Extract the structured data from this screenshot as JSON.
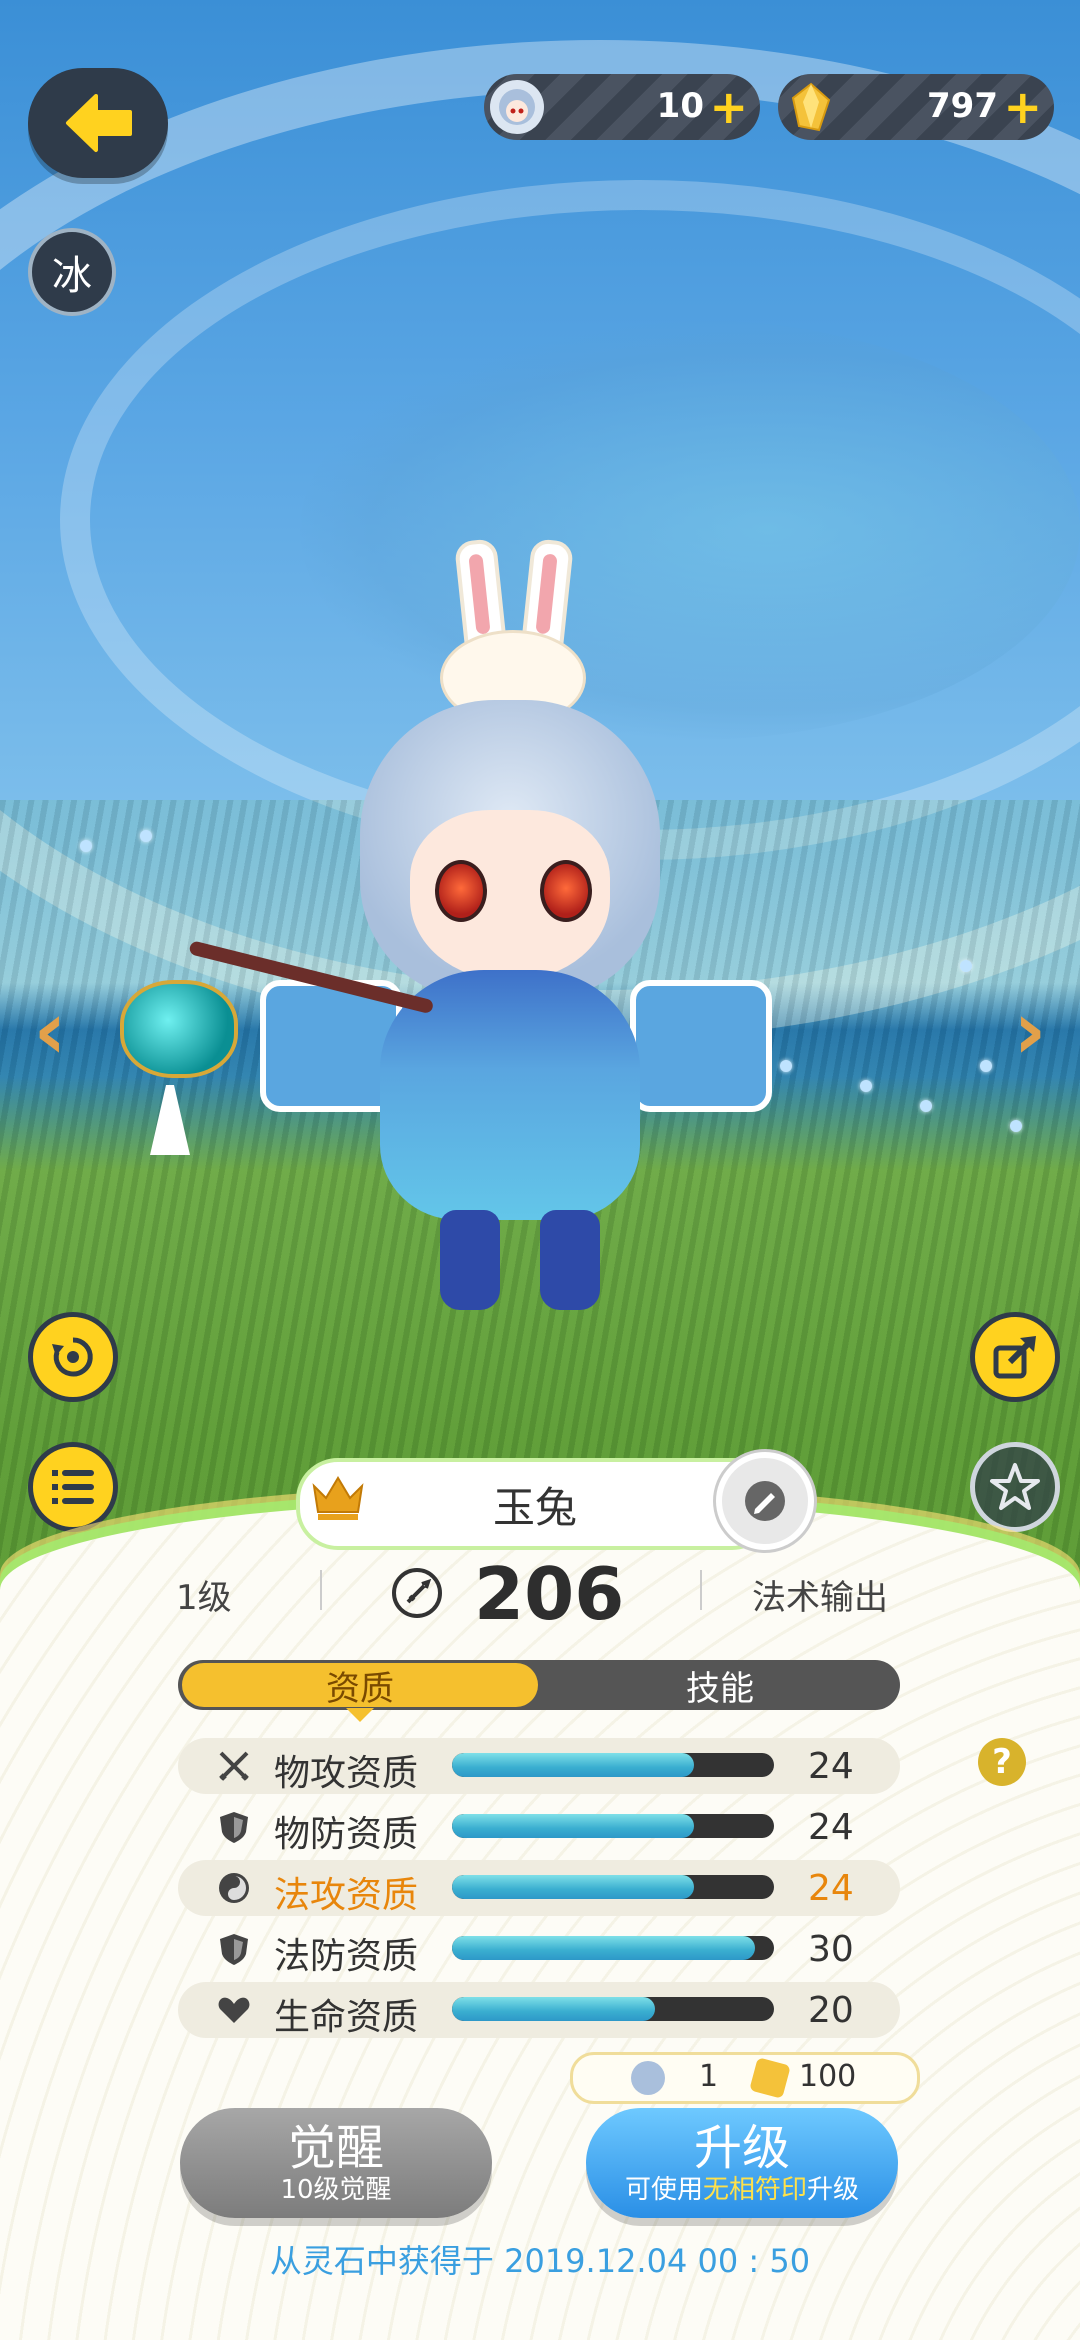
{
  "header": {
    "soul_count": "10",
    "crystal_count": "797",
    "plus_symbol": "+",
    "element_badge": "冰"
  },
  "pet": {
    "name": "玉兔",
    "level": "1级",
    "power": "206",
    "role": "法术输出"
  },
  "tabs": {
    "active": "资质",
    "inactive": "技能"
  },
  "attributes": [
    {
      "label": "物攻资质",
      "value": "24",
      "fill": 0.75,
      "icon": "crossed-swords-icon",
      "highlight": false
    },
    {
      "label": "物防资质",
      "value": "24",
      "fill": 0.75,
      "icon": "shield-icon",
      "highlight": false
    },
    {
      "label": "法攻资质",
      "value": "24",
      "fill": 0.75,
      "icon": "magic-orb-icon",
      "highlight": true
    },
    {
      "label": "法防资质",
      "value": "30",
      "fill": 0.94,
      "icon": "shield-icon",
      "highlight": false
    },
    {
      "label": "生命资质",
      "value": "20",
      "fill": 0.63,
      "icon": "heart-icon",
      "highlight": false
    }
  ],
  "cost": {
    "soul": "1",
    "crystal": "100"
  },
  "buttons": {
    "awaken_label": "觉醒",
    "awaken_sub": "10级觉醒",
    "upgrade_label": "升级",
    "upgrade_sub_prefix": "可使用",
    "upgrade_sub_highlight": "无相符印",
    "upgrade_sub_suffix": "升级"
  },
  "footer": {
    "source_text": "从灵石中获得于 2019.12.04   00 : 50"
  },
  "colors": {
    "accent_yellow": "#ffd21f",
    "tab_active": "#f5c02e",
    "highlight_orange": "#e8860c",
    "upgrade_blue": "#2a8fe6",
    "footer_blue": "#3a9fe0"
  }
}
